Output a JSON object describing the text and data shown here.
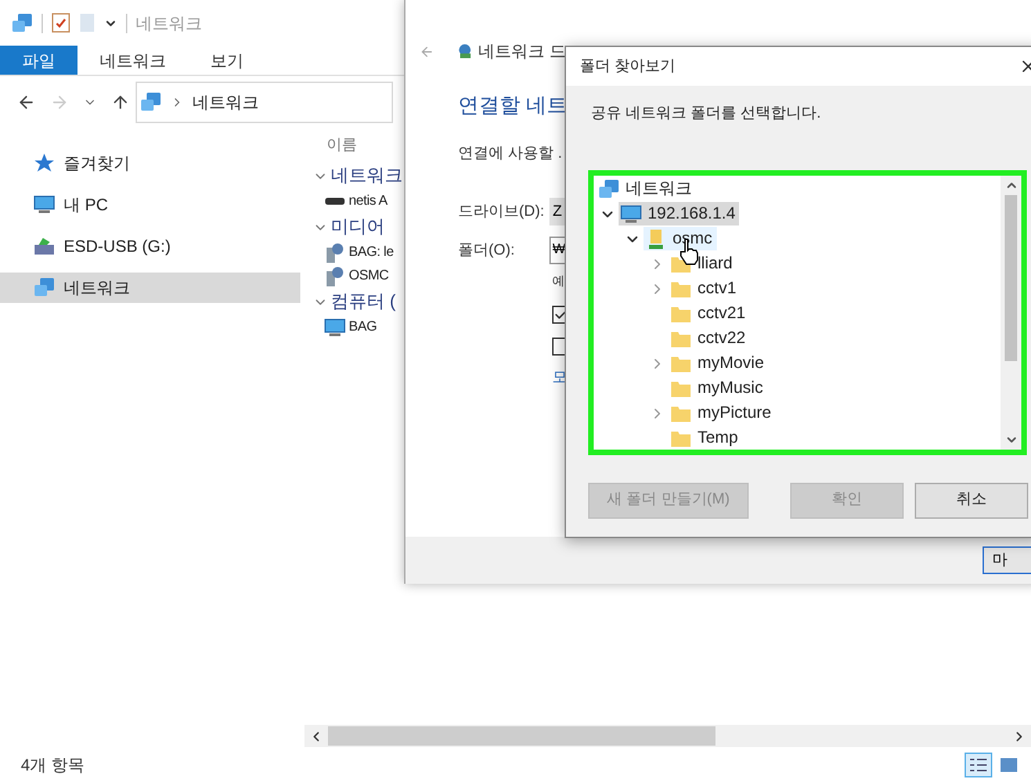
{
  "explorer": {
    "title": "네트워크",
    "ribbon_tabs": [
      {
        "label": "파일",
        "selected": true
      },
      {
        "label": "네트워크",
        "selected": false
      },
      {
        "label": "보기",
        "selected": false
      }
    ],
    "address": "네트워크",
    "nav_items": [
      {
        "label": "즐겨찾기",
        "kind": "star",
        "selected": false
      },
      {
        "label": "내 PC",
        "kind": "pc",
        "selected": false
      },
      {
        "label": "ESD-USB (G:)",
        "kind": "usb",
        "selected": false
      },
      {
        "label": "네트워크",
        "kind": "network",
        "selected": true
      }
    ],
    "column_header": "이름",
    "groups": [
      {
        "label": "네트워크",
        "items": [
          {
            "label": "netis A",
            "kind": "router"
          }
        ]
      },
      {
        "label": "미디어",
        "items": [
          {
            "label": "BAG: le",
            "kind": "media"
          },
          {
            "label": "OSMC",
            "kind": "media"
          }
        ]
      },
      {
        "label": "컴퓨터 (",
        "items": [
          {
            "label": "BAG",
            "kind": "pc"
          }
        ]
      }
    ],
    "status": "4개 항목",
    "views": [
      {
        "kind": "details",
        "selected": true
      },
      {
        "kind": "tiles",
        "selected": false
      }
    ]
  },
  "wizard": {
    "title": "네트워크 드",
    "heading": "연결할 네트",
    "prompt": "연결에 사용할 .",
    "drive_label": "드라이브(D):",
    "drive_value": "Z",
    "folder_label": "폴더(O):",
    "folder_value": "₩",
    "example": "예",
    "checkboxes": [
      {
        "checked": true
      },
      {
        "checked": false
      }
    ],
    "link": "모",
    "finish_button": "마"
  },
  "dialog": {
    "title": "폴더 찾아보기",
    "instruction": "공유 네트워크 폴더를 선택합니다.",
    "tree": [
      {
        "label": "네트워크",
        "kind": "network",
        "selected": false,
        "children": [
          {
            "label": "192.168.1.4",
            "kind": "pc",
            "selected": true,
            "expanded": true,
            "children": [
              {
                "label": "osmc",
                "kind": "share",
                "selected": false,
                "hovered": true,
                "expanded": true,
                "children": [
                  {
                    "label": "lliard",
                    "kind": "folder",
                    "selected": false,
                    "expandable": true
                  },
                  {
                    "label": "cctv1",
                    "kind": "folder",
                    "selected": false,
                    "expandable": true
                  },
                  {
                    "label": "cctv21",
                    "kind": "folder",
                    "selected": false,
                    "expandable": false
                  },
                  {
                    "label": "cctv22",
                    "kind": "folder",
                    "selected": false,
                    "expandable": false
                  },
                  {
                    "label": "myMovie",
                    "kind": "folder",
                    "selected": false,
                    "expandable": true
                  },
                  {
                    "label": "myMusic",
                    "kind": "folder",
                    "selected": false,
                    "expandable": false
                  },
                  {
                    "label": "myPicture",
                    "kind": "folder",
                    "selected": false,
                    "expandable": true
                  },
                  {
                    "label": "Temp",
                    "kind": "folder",
                    "selected": false,
                    "expandable": false
                  }
                ]
              }
            ]
          }
        ]
      }
    ],
    "buttons": [
      {
        "label": "새 폴더 만들기(M)",
        "disabled": true
      },
      {
        "label": "확인",
        "disabled": true
      },
      {
        "label": "취소",
        "disabled": false
      }
    ]
  }
}
